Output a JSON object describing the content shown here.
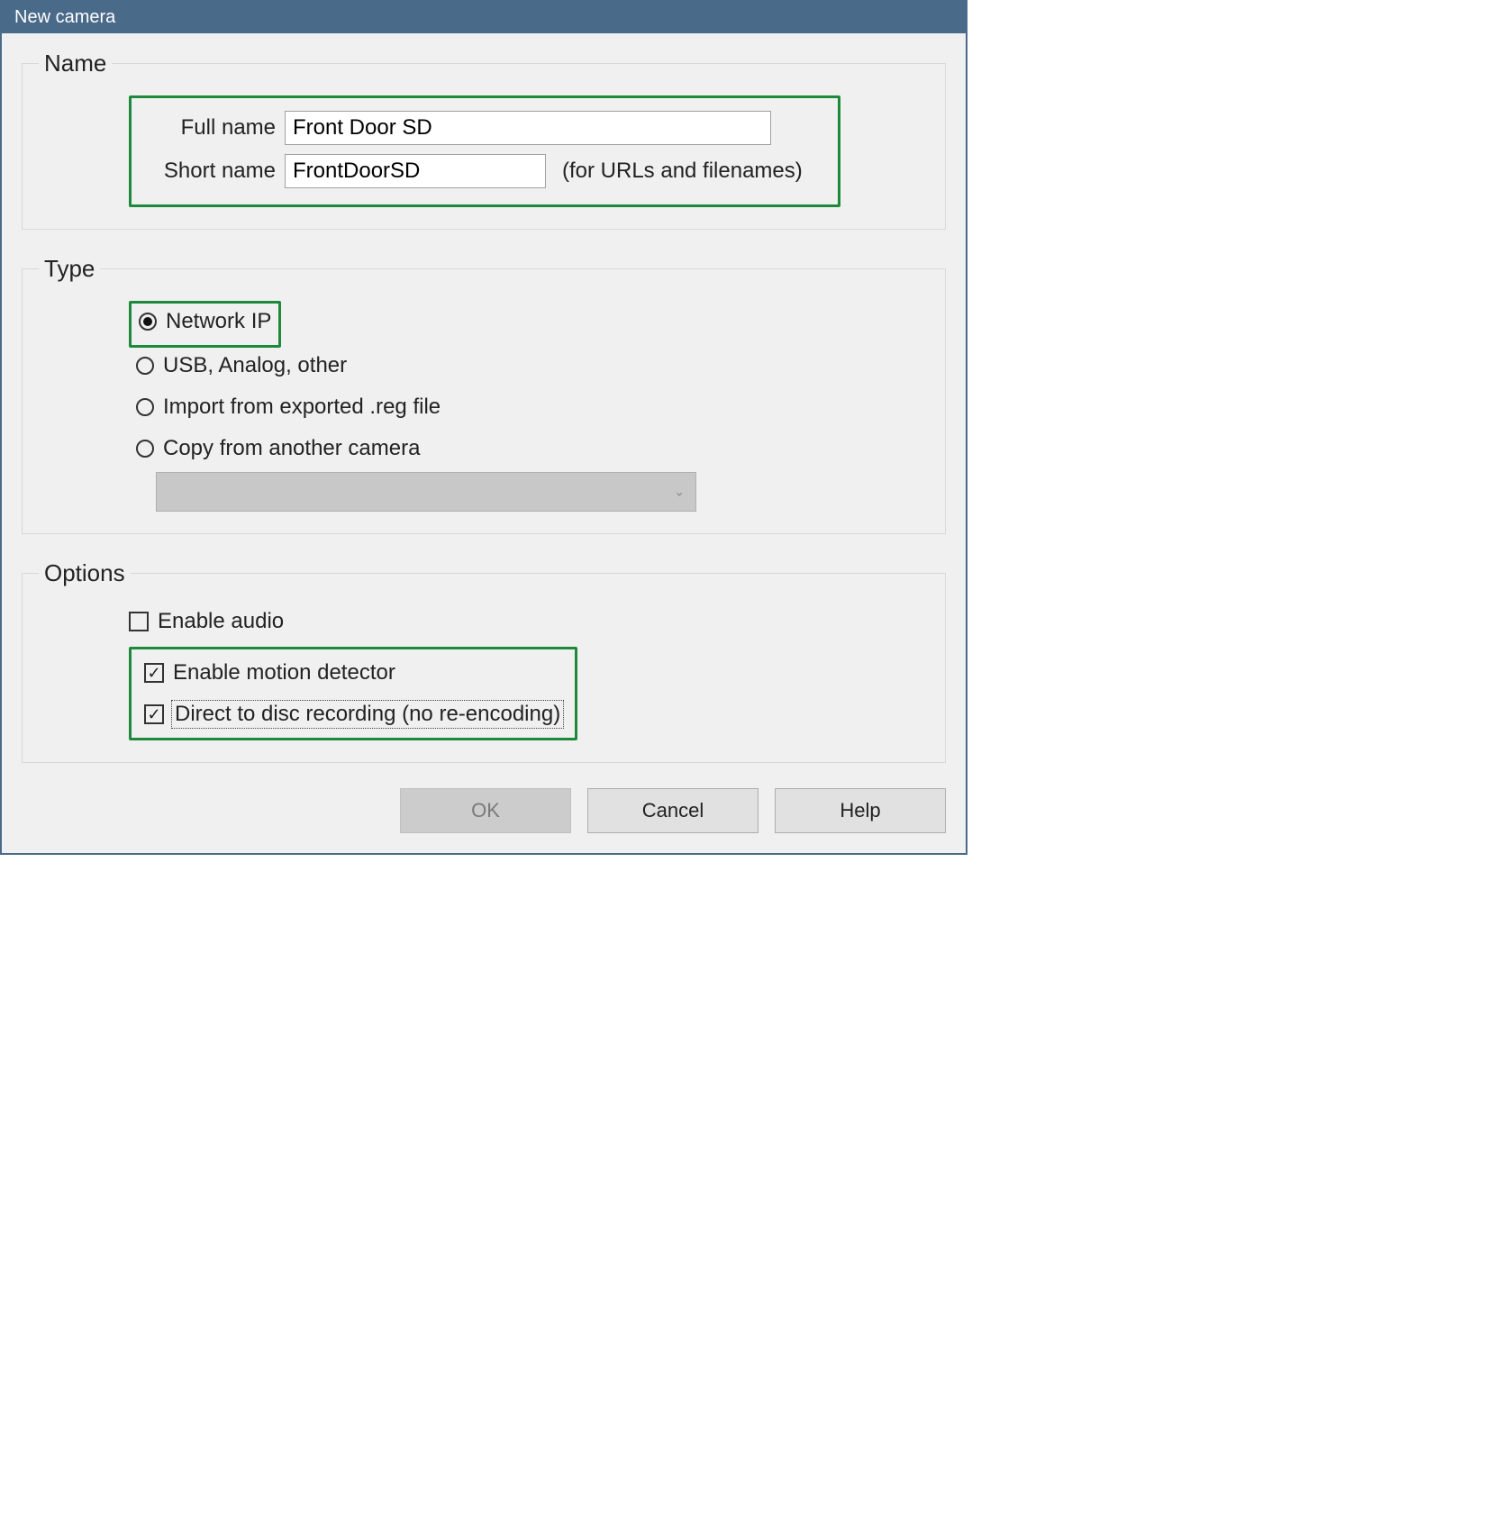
{
  "window": {
    "title": "New camera"
  },
  "groups": {
    "name": {
      "legend": "Name",
      "full_label": "Full name",
      "full_value": "Front Door SD",
      "short_label": "Short name",
      "short_value": "FrontDoorSD",
      "short_hint": "(for URLs and filenames)"
    },
    "type": {
      "legend": "Type",
      "options": {
        "network_ip": "Network IP",
        "usb_analog": "USB, Analog, other",
        "import_reg": "Import from exported .reg file",
        "copy_camera": "Copy from another camera"
      },
      "selected": "network_ip",
      "copy_dropdown_value": ""
    },
    "options": {
      "legend": "Options",
      "checks": {
        "audio": {
          "label": "Enable audio",
          "checked": false
        },
        "motion": {
          "label": "Enable motion detector",
          "checked": true
        },
        "direct": {
          "label": "Direct to disc recording (no re-encoding)",
          "checked": true
        }
      }
    }
  },
  "buttons": {
    "ok": "OK",
    "cancel": "Cancel",
    "help": "Help"
  }
}
